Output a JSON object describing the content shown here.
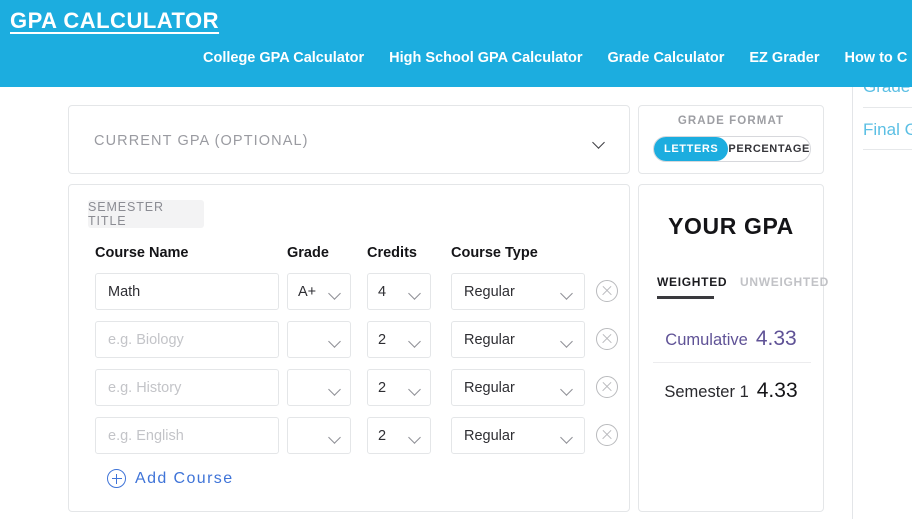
{
  "header": {
    "brand": "GPA CALCULATOR",
    "nav": [
      {
        "label": "College GPA Calculator"
      },
      {
        "label": "High School GPA Calculator"
      },
      {
        "label": "Grade Calculator"
      },
      {
        "label": "EZ Grader"
      },
      {
        "label": "How to C"
      }
    ]
  },
  "far_sidebar": {
    "links": [
      {
        "label": "Grade"
      },
      {
        "label": "Final G"
      }
    ]
  },
  "current_gpa": {
    "label": "CURRENT GPA (OPTIONAL)"
  },
  "semester": {
    "title_placeholder": "SEMESTER TITLE",
    "columns": {
      "name": "Course Name",
      "grade": "Grade",
      "credits": "Credits",
      "type": "Course Type"
    },
    "rows": [
      {
        "name": "Math",
        "name_empty": false,
        "grade": "A+",
        "credits": "4",
        "type": "Regular"
      },
      {
        "name": "e.g. Biology",
        "name_empty": true,
        "grade": "",
        "credits": "2",
        "type": "Regular"
      },
      {
        "name": "e.g. History",
        "name_empty": true,
        "grade": "",
        "credits": "2",
        "type": "Regular"
      },
      {
        "name": "e.g. English",
        "name_empty": true,
        "grade": "",
        "credits": "2",
        "type": "Regular"
      }
    ],
    "add_course_label": "Add Course"
  },
  "grade_format": {
    "title": "GRADE FORMAT",
    "options": [
      {
        "label": "LETTERS",
        "active": true
      },
      {
        "label": "PERCENTAGE",
        "active": false
      }
    ]
  },
  "your_gpa": {
    "title": "YOUR GPA",
    "tabs": [
      {
        "label": "WEIGHTED",
        "active": true
      },
      {
        "label": "UNWEIGHTED",
        "active": false
      }
    ],
    "cumulative_label": "Cumulative",
    "cumulative_value": "4.33",
    "semester_label": "Semester 1",
    "semester_value": "4.33"
  },
  "colors": {
    "header_blue": "#1CADDF",
    "link_blue": "#3f74d8",
    "sidebar_link_blue": "#5bbfe4",
    "cumulative_purple": "#5f5296"
  }
}
